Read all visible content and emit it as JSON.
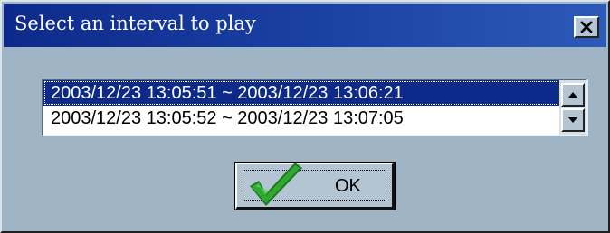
{
  "window": {
    "title": "Select an interval to play",
    "close_icon": "close-x-icon"
  },
  "list": {
    "items": [
      {
        "label": "2003/12/23 13:05:51 ~ 2003/12/23 13:06:21",
        "selected": true
      },
      {
        "label": "2003/12/23 13:05:52 ~ 2003/12/23 13:07:05",
        "selected": false
      }
    ]
  },
  "scrollbar": {
    "up_icon": "arrow-up-icon",
    "down_icon": "arrow-down-icon"
  },
  "ok_button": {
    "label": "OK",
    "icon": "checkmark-icon"
  },
  "colors": {
    "title_bar": "#0d2a8a",
    "dialog_bg": "#9fb5c6",
    "selection": "#0d2a8a",
    "check_green": "#2fa92f"
  }
}
